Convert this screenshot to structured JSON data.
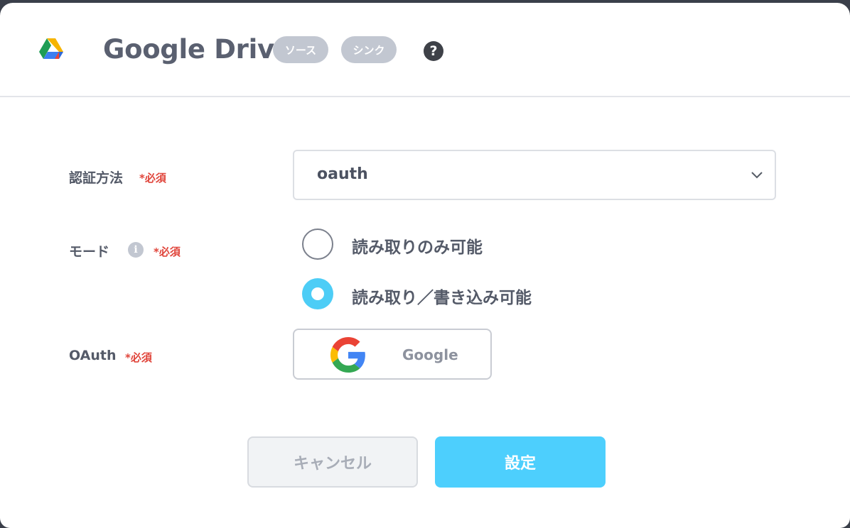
{
  "header": {
    "title": "Google Drive",
    "tags": [
      "ソース",
      "シンク"
    ],
    "help_glyph": "?",
    "logo_icon": "google-drive-icon"
  },
  "form": {
    "auth_method": {
      "label": "認証方法",
      "required": "*必須",
      "selected_value": "oauth"
    },
    "mode": {
      "label": "モード",
      "required": "*必須",
      "info_glyph": "i",
      "options": [
        {
          "label": "読み取りのみ可能",
          "selected": false
        },
        {
          "label": "読み取り／書き込み可能",
          "selected": true
        }
      ]
    },
    "oauth": {
      "label": "OAuth",
      "required": "*必須",
      "button_label": "Google"
    }
  },
  "footer": {
    "cancel_label": "キャンセル",
    "confirm_label": "設定"
  },
  "colors": {
    "accent": "#4dcdf6",
    "required": "#e0453b",
    "tag_bg": "#c2c7d1"
  }
}
